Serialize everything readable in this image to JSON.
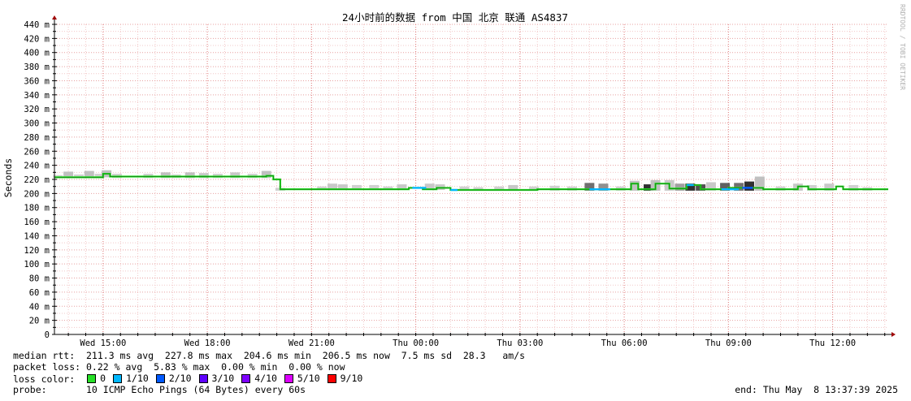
{
  "chart_data": {
    "type": "line",
    "title": "24小时前的数据 from 中国 北京 联通 AS4837",
    "ylabel": "Seconds",
    "watermark": "RRDTOOL / TOBI OETIKER",
    "ylim": [
      0,
      440
    ],
    "y_ticks": [
      {
        "v": 0,
        "label": "0"
      },
      {
        "v": 20,
        "label": "20 m"
      },
      {
        "v": 40,
        "label": "40 m"
      },
      {
        "v": 60,
        "label": "60 m"
      },
      {
        "v": 80,
        "label": "80 m"
      },
      {
        "v": 100,
        "label": "100 m"
      },
      {
        "v": 120,
        "label": "120 m"
      },
      {
        "v": 140,
        "label": "140 m"
      },
      {
        "v": 160,
        "label": "160 m"
      },
      {
        "v": 180,
        "label": "180 m"
      },
      {
        "v": 200,
        "label": "200 m"
      },
      {
        "v": 220,
        "label": "220 m"
      },
      {
        "v": 240,
        "label": "240 m"
      },
      {
        "v": 260,
        "label": "260 m"
      },
      {
        "v": 280,
        "label": "280 m"
      },
      {
        "v": 300,
        "label": "300 m"
      },
      {
        "v": 320,
        "label": "320 m"
      },
      {
        "v": 340,
        "label": "340 m"
      },
      {
        "v": 360,
        "label": "360 m"
      },
      {
        "v": 380,
        "label": "380 m"
      },
      {
        "v": 400,
        "label": "400 m"
      },
      {
        "v": 420,
        "label": "420 m"
      },
      {
        "v": 440,
        "label": "440 m"
      }
    ],
    "x_range_hours": [
      13.6,
      37.6
    ],
    "x_ticks": [
      {
        "h": 15,
        "label": "Wed 15:00"
      },
      {
        "h": 18,
        "label": "Wed 18:00"
      },
      {
        "h": 21,
        "label": "Wed 21:00"
      },
      {
        "h": 24,
        "label": "Thu 00:00"
      },
      {
        "h": 27,
        "label": "Thu 03:00"
      },
      {
        "h": 30,
        "label": "Thu 06:00"
      },
      {
        "h": 33,
        "label": "Thu 09:00"
      },
      {
        "h": 36,
        "label": "Thu 12:00"
      }
    ],
    "grid": true,
    "series": [
      {
        "name": "median rtt",
        "color": "#22dd22",
        "points": [
          [
            13.6,
            223
          ],
          [
            14.8,
            223
          ],
          [
            15.0,
            228
          ],
          [
            15.2,
            224
          ],
          [
            17.0,
            224
          ],
          [
            19.2,
            224
          ],
          [
            19.7,
            225
          ],
          [
            19.9,
            220
          ],
          [
            20.1,
            206
          ],
          [
            21.0,
            206
          ],
          [
            22.5,
            206
          ],
          [
            23.4,
            206
          ],
          [
            23.8,
            208
          ],
          [
            24.2,
            206
          ],
          [
            24.6,
            208
          ],
          [
            25.0,
            205
          ],
          [
            26.5,
            205
          ],
          [
            27.5,
            206
          ],
          [
            29.5,
            206
          ],
          [
            30.0,
            206
          ],
          [
            30.2,
            214
          ],
          [
            30.4,
            206
          ],
          [
            30.9,
            214
          ],
          [
            31.3,
            207
          ],
          [
            31.8,
            212
          ],
          [
            32.2,
            206
          ],
          [
            33.0,
            208
          ],
          [
            33.6,
            208
          ],
          [
            34.0,
            206
          ],
          [
            34.8,
            206
          ],
          [
            35.0,
            210
          ],
          [
            35.3,
            206
          ],
          [
            36.0,
            206
          ],
          [
            36.1,
            210
          ],
          [
            36.3,
            206
          ],
          [
            37.6,
            206
          ]
        ],
        "loss_segments": [
          {
            "from": 23.9,
            "to": 24.3,
            "loss": "1/10"
          },
          {
            "from": 25.0,
            "to": 25.2,
            "loss": "1/10"
          },
          {
            "from": 29.0,
            "to": 29.6,
            "loss": "1/10"
          },
          {
            "from": 31.8,
            "to": 32.0,
            "loss": "1/10"
          },
          {
            "from": 32.8,
            "to": 33.3,
            "loss": "1/10"
          },
          {
            "from": 33.4,
            "to": 33.7,
            "loss": "2/10"
          }
        ]
      }
    ],
    "smoke": [
      {
        "h": 13.7,
        "lo": 222,
        "hi": 226,
        "shade": "#d0d0d0"
      },
      {
        "h": 14.0,
        "lo": 222,
        "hi": 231,
        "shade": "#c0c0c0"
      },
      {
        "h": 14.3,
        "lo": 222,
        "hi": 227,
        "shade": "#d0d0d0"
      },
      {
        "h": 14.6,
        "lo": 222,
        "hi": 232,
        "shade": "#c0c0c0"
      },
      {
        "h": 14.9,
        "lo": 222,
        "hi": 228,
        "shade": "#d0d0d0"
      },
      {
        "h": 15.1,
        "lo": 223,
        "hi": 233,
        "shade": "#c0c0c0"
      },
      {
        "h": 15.4,
        "lo": 222,
        "hi": 228,
        "shade": "#d0d0d0"
      },
      {
        "h": 16.3,
        "lo": 222,
        "hi": 228,
        "shade": "#d0d0d0"
      },
      {
        "h": 16.8,
        "lo": 222,
        "hi": 230,
        "shade": "#c0c0c0"
      },
      {
        "h": 17.1,
        "lo": 222,
        "hi": 227,
        "shade": "#d0d0d0"
      },
      {
        "h": 17.5,
        "lo": 222,
        "hi": 230,
        "shade": "#c0c0c0"
      },
      {
        "h": 17.9,
        "lo": 222,
        "hi": 229,
        "shade": "#c8c8c8"
      },
      {
        "h": 18.3,
        "lo": 222,
        "hi": 228,
        "shade": "#d0d0d0"
      },
      {
        "h": 18.8,
        "lo": 222,
        "hi": 230,
        "shade": "#c8c8c8"
      },
      {
        "h": 19.3,
        "lo": 222,
        "hi": 228,
        "shade": "#d0d0d0"
      },
      {
        "h": 19.7,
        "lo": 222,
        "hi": 232,
        "shade": "#c0c0c0"
      },
      {
        "h": 20.1,
        "lo": 204,
        "hi": 208,
        "shade": "#d0d0d0"
      },
      {
        "h": 21.3,
        "lo": 205,
        "hi": 210,
        "shade": "#d0d0d0"
      },
      {
        "h": 21.6,
        "lo": 205,
        "hi": 214,
        "shade": "#c8c8c8"
      },
      {
        "h": 21.9,
        "lo": 205,
        "hi": 213,
        "shade": "#c8c8c8"
      },
      {
        "h": 22.3,
        "lo": 205,
        "hi": 212,
        "shade": "#d0d0d0"
      },
      {
        "h": 22.8,
        "lo": 205,
        "hi": 212,
        "shade": "#d0d0d0"
      },
      {
        "h": 23.2,
        "lo": 205,
        "hi": 210,
        "shade": "#d0d0d0"
      },
      {
        "h": 23.6,
        "lo": 205,
        "hi": 213,
        "shade": "#c8c8c8"
      },
      {
        "h": 24.4,
        "lo": 205,
        "hi": 214,
        "shade": "#c8c8c8"
      },
      {
        "h": 24.7,
        "lo": 205,
        "hi": 213,
        "shade": "#c8c8c8"
      },
      {
        "h": 25.4,
        "lo": 204,
        "hi": 210,
        "shade": "#d0d0d0"
      },
      {
        "h": 25.8,
        "lo": 204,
        "hi": 209,
        "shade": "#d0d0d0"
      },
      {
        "h": 26.4,
        "lo": 204,
        "hi": 210,
        "shade": "#d0d0d0"
      },
      {
        "h": 26.8,
        "lo": 204,
        "hi": 212,
        "shade": "#c8c8c8"
      },
      {
        "h": 27.4,
        "lo": 204,
        "hi": 210,
        "shade": "#d0d0d0"
      },
      {
        "h": 28.0,
        "lo": 204,
        "hi": 211,
        "shade": "#d0d0d0"
      },
      {
        "h": 28.5,
        "lo": 204,
        "hi": 210,
        "shade": "#d0d0d0"
      },
      {
        "h": 29.0,
        "lo": 204,
        "hi": 215,
        "shade": "#707070"
      },
      {
        "h": 29.4,
        "lo": 204,
        "hi": 214,
        "shade": "#909090"
      },
      {
        "h": 29.9,
        "lo": 204,
        "hi": 210,
        "shade": "#d0d0d0"
      },
      {
        "h": 30.3,
        "lo": 204,
        "hi": 218,
        "shade": "#c0c0c0"
      },
      {
        "h": 30.7,
        "lo": 204,
        "hi": 213,
        "shade": "#303030"
      },
      {
        "h": 30.9,
        "lo": 204,
        "hi": 219,
        "shade": "#c0c0c0"
      },
      {
        "h": 31.3,
        "lo": 204,
        "hi": 219,
        "shade": "#c8c8c8"
      },
      {
        "h": 31.6,
        "lo": 204,
        "hi": 214,
        "shade": "#a0a0a0"
      },
      {
        "h": 31.9,
        "lo": 204,
        "hi": 214,
        "shade": "#303030"
      },
      {
        "h": 32.2,
        "lo": 204,
        "hi": 213,
        "shade": "#505050"
      },
      {
        "h": 32.5,
        "lo": 204,
        "hi": 216,
        "shade": "#c8c8c8"
      },
      {
        "h": 32.9,
        "lo": 204,
        "hi": 215,
        "shade": "#606060"
      },
      {
        "h": 33.3,
        "lo": 204,
        "hi": 215,
        "shade": "#707070"
      },
      {
        "h": 33.6,
        "lo": 204,
        "hi": 217,
        "shade": "#303030"
      },
      {
        "h": 33.9,
        "lo": 204,
        "hi": 224,
        "shade": "#c0c0c0"
      },
      {
        "h": 34.5,
        "lo": 204,
        "hi": 210,
        "shade": "#d0d0d0"
      },
      {
        "h": 35.0,
        "lo": 204,
        "hi": 214,
        "shade": "#c8c8c8"
      },
      {
        "h": 35.4,
        "lo": 204,
        "hi": 212,
        "shade": "#d0d0d0"
      },
      {
        "h": 35.9,
        "lo": 204,
        "hi": 214,
        "shade": "#c8c8c8"
      },
      {
        "h": 36.6,
        "lo": 204,
        "hi": 212,
        "shade": "#d0d0d0"
      },
      {
        "h": 37.0,
        "lo": 204,
        "hi": 209,
        "shade": "#d0d0d0"
      }
    ]
  },
  "stats": {
    "median_rtt": "median rtt:  211.3 ms avg  227.8 ms max  204.6 ms min  206.5 ms now  7.5 ms sd  28.3   am/s",
    "packet_loss": "packet loss: 0.22 % avg  5.83 % max  0.00 % min  0.00 % now",
    "loss_color_label": "loss color:",
    "probe": "probe:       10 ICMP Echo Pings (64 Bytes) every 60s",
    "end": "end: Thu May  8 13:37:39 2025"
  },
  "legend": [
    {
      "label": "0",
      "color": "#26e026"
    },
    {
      "label": "1/10",
      "color": "#00b8ff"
    },
    {
      "label": "2/10",
      "color": "#0059ff"
    },
    {
      "label": "3/10",
      "color": "#5e00ff"
    },
    {
      "label": "4/10",
      "color": "#7e00ff"
    },
    {
      "label": "5/10",
      "color": "#dd00ff"
    },
    {
      "label": "9/10",
      "color": "#ff0000"
    }
  ],
  "loss_colors": {
    "1/10": "#00b8ff",
    "2/10": "#0059ff"
  }
}
